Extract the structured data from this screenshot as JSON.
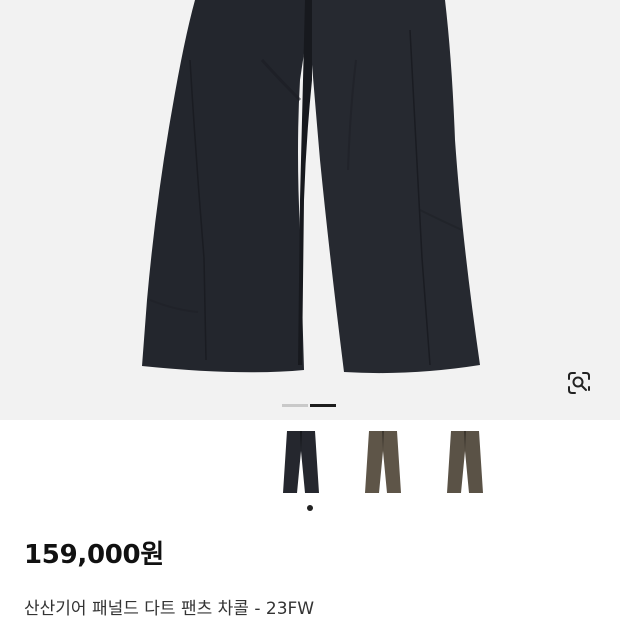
{
  "product": {
    "price": "159,000원",
    "title": "산산기어 패널드 다트 팬츠 차콜 - 23FW"
  },
  "gallery": {
    "current_index": 2,
    "total": 2,
    "lens_icon": "visual-search-icon"
  },
  "swatches": [
    {
      "name": "charcoal",
      "color": "#25272e",
      "selected": true
    },
    {
      "name": "brown",
      "color": "#5e5548",
      "selected": false
    },
    {
      "name": "brown-2",
      "color": "#5a5246",
      "selected": false
    }
  ],
  "colors": {
    "hero_bg": "#f2f2f2",
    "pants_main": "#23262d",
    "pants_shadow": "#1a1c22"
  }
}
